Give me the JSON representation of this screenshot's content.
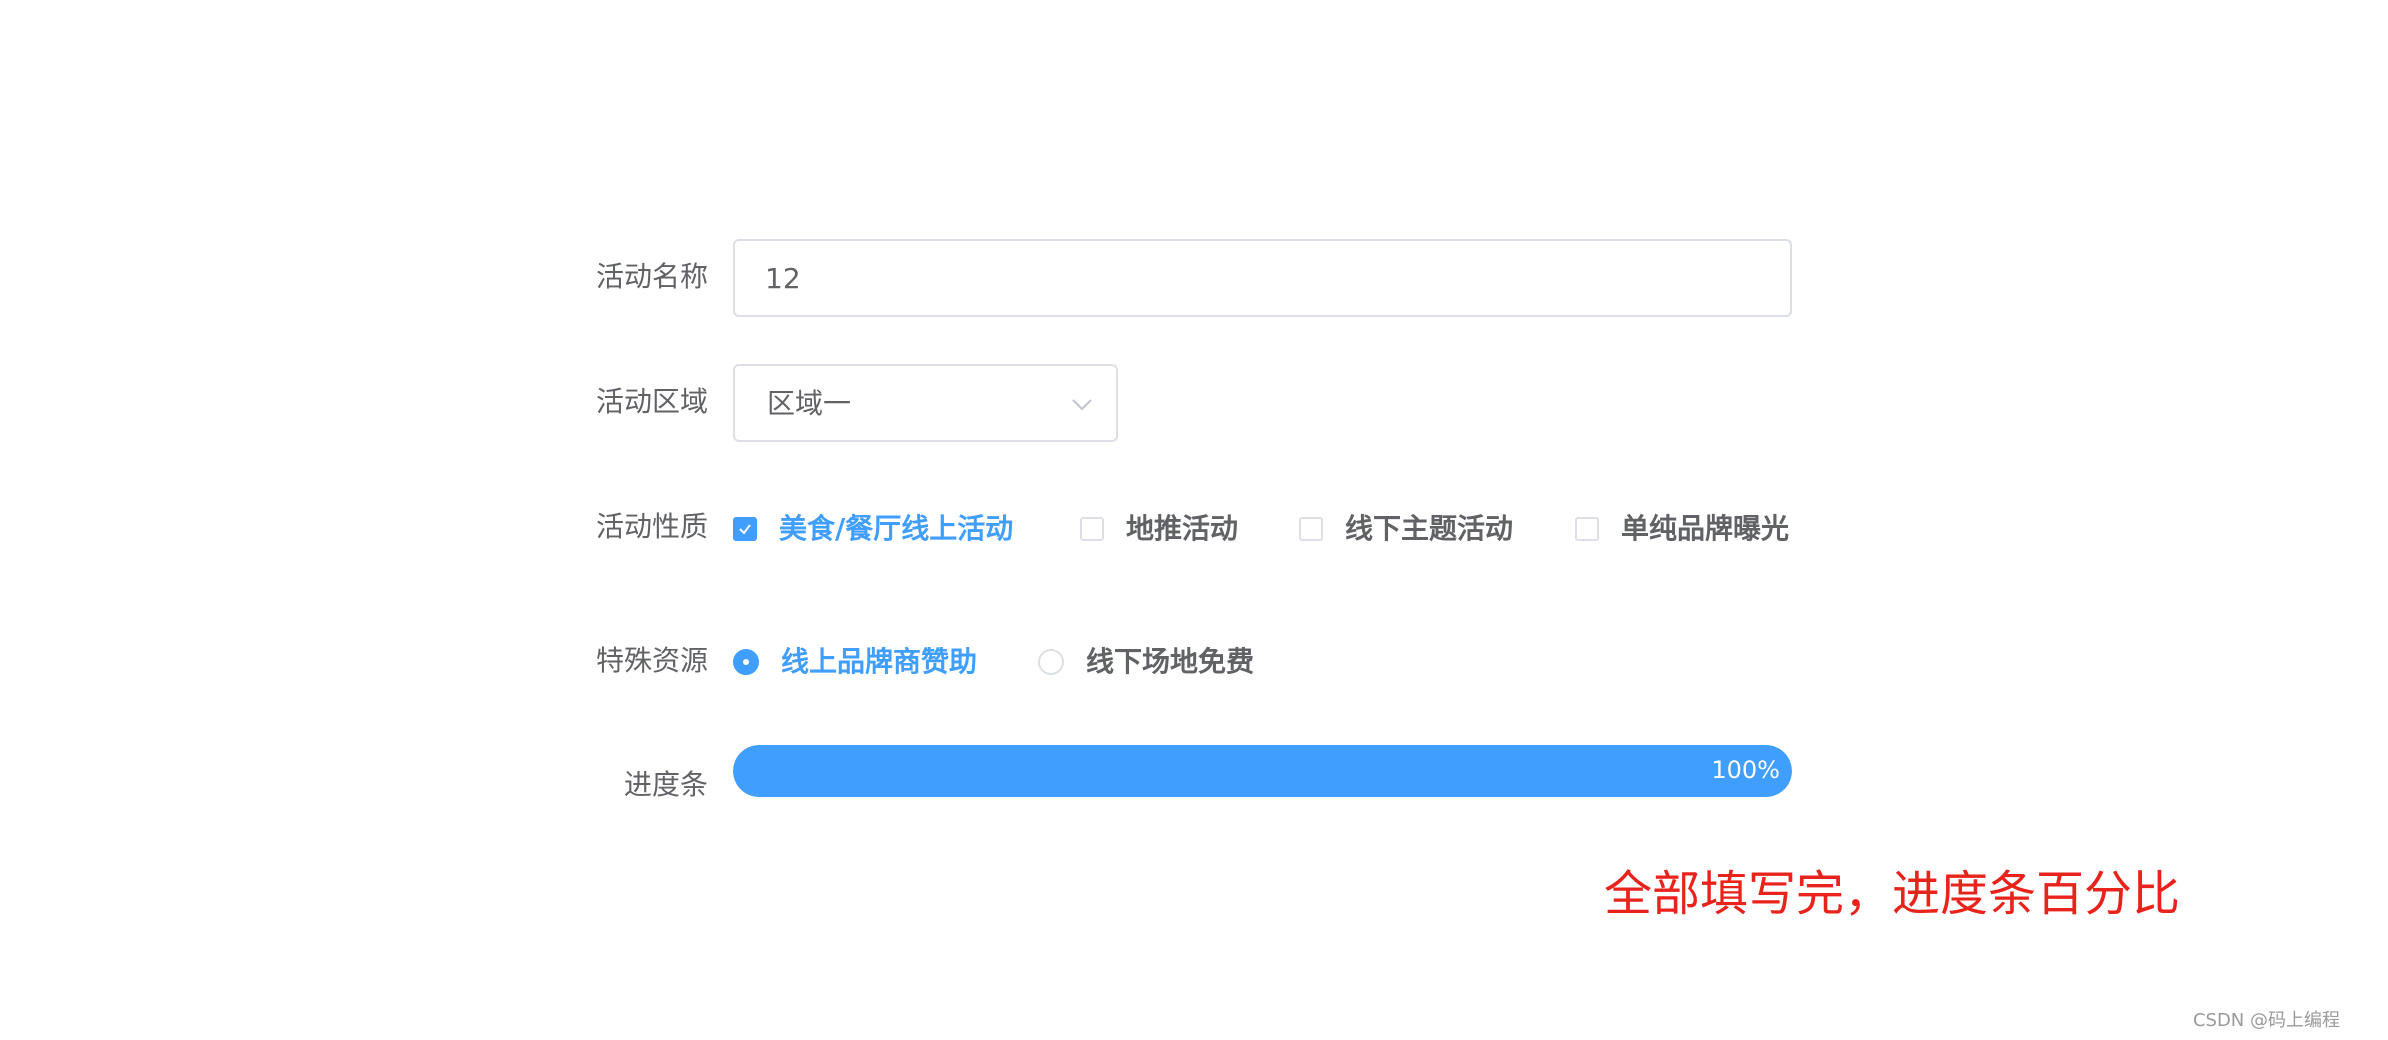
{
  "form": {
    "name": {
      "label": "活动名称",
      "value": "12"
    },
    "region": {
      "label": "活动区域",
      "selected": "区域一"
    },
    "type": {
      "label": "活动性质",
      "options": [
        {
          "label": "美食/餐厅线上活动",
          "checked": true
        },
        {
          "label": "地推活动",
          "checked": false
        },
        {
          "label": "线下主题活动",
          "checked": false
        },
        {
          "label": "单纯品牌曝光",
          "checked": false
        }
      ]
    },
    "resource": {
      "label": "特殊资源",
      "options": [
        {
          "label": "线上品牌商赞助",
          "checked": true
        },
        {
          "label": "线下场地免费",
          "checked": false
        }
      ]
    },
    "progress": {
      "label": "进度条",
      "percent": 100,
      "text": "100%"
    }
  },
  "annotation": "全部填写完，进度条百分比",
  "watermark": "CSDN @码上编程",
  "colors": {
    "primary": "#409eff",
    "border": "#dcdfe6",
    "text": "#606266",
    "annotation": "#e8231b"
  },
  "icons": {
    "select_arrow": "chevron-down-icon",
    "checkbox_check": "check-icon"
  }
}
